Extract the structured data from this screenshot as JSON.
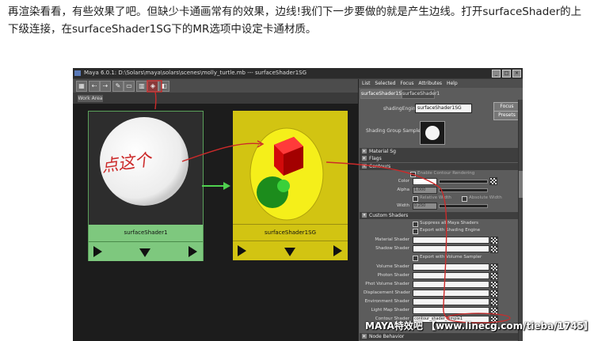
{
  "article": {
    "text": "再渲染看看，有些效果了吧。但缺少卡通画常有的效果，边线!我们下一步要做的就是产生边线。打开surfaceShader的上下级连接，在surfaceShader1SG下的MR选项中设定卡通材质。"
  },
  "maya": {
    "title": "Maya 6.0.1: D:\\Solars\\maya\\solars\\scenes\\molly_turtle.mb   ---   surfaceShader1SG",
    "window_buttons": [
      "_",
      "□",
      "×"
    ],
    "toolbar_icons": [
      "graph-icon",
      "input-connections-icon",
      "output-connections-icon",
      "io-connections-icon",
      "clear-graph-icon",
      "rearrange-icon"
    ],
    "work_area_tab": "Work Area",
    "node1_label": "surfaceShader1",
    "node2_label": "surfaceShader1SG",
    "handwriting": "点这个",
    "attr_menu": [
      "List",
      "Selected",
      "Focus",
      "Attributes",
      "Help"
    ],
    "attr_tabs": [
      "surfaceShader1SG",
      "surfaceShader1"
    ],
    "shading_engine_label": "shadingEngine:",
    "shading_engine_value": "surfaceShader1SG",
    "focus_button": "Focus",
    "presets_button": "Presets",
    "shading_group_sample": "Shading Group Sample",
    "sections": {
      "material": "Material Sg",
      "flags": "Flags",
      "contours": "Contours",
      "custom_shaders": "Custom Shaders",
      "node_behavior": "Node Behavior"
    },
    "contours": {
      "enable": "Enable Contour Rendering",
      "color_label": "Color",
      "alpha_label": "Alpha",
      "alpha_value": "1.000",
      "relative_width": "Relative Width",
      "absolute_width": "Absolute Width",
      "width_label": "Width",
      "width_value": "0.250"
    },
    "custom": {
      "suppress": "Suppress all Maya Shaders",
      "export_sg": "Export with Shading Engine",
      "material_shader": "Material Shader",
      "shadow_shader": "Shadow Shader",
      "export_vol": "Export with Volume Sampler",
      "volume_shader": "Volume Shader",
      "photon_shader": "Photon Shader",
      "photon_volume_shader": "Phot Volume Shader",
      "displacement_shader": "Displacement Shader",
      "environment_shader": "Environment Shader",
      "light_map_shader": "Light Map Shader",
      "contour_shader": "Contour Shader",
      "contour_shader_value": "contour_shader_simple1"
    },
    "watermark": "MAYA特效吧 【www.linecg.com/tieba/1745】"
  },
  "colors": {
    "node1_header": "#7ec87e",
    "node2_body": "#d2c412",
    "annotation_red": "#cc2a2a",
    "connection_green": "#4fd14f"
  }
}
